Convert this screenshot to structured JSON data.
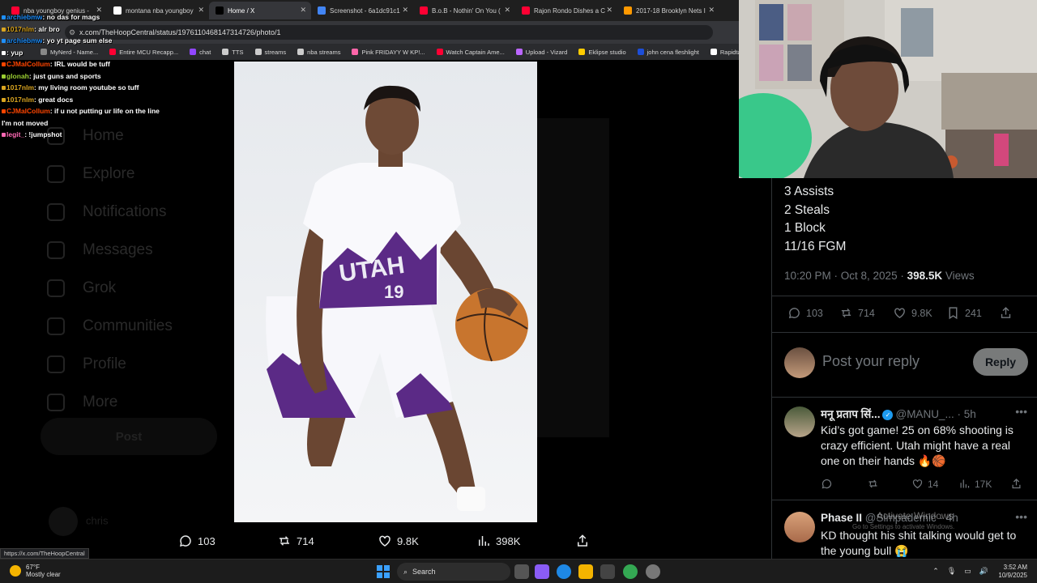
{
  "browser": {
    "tabs": [
      {
        "label": "nba youngboy genius -",
        "color": "#ff0033"
      },
      {
        "label": "montana nba youngboy",
        "color": "#ffffff"
      },
      {
        "label": "Home / X",
        "color": "#000000",
        "active": true
      },
      {
        "label": "Screenshot - 6a1dc91c1",
        "color": "#4285f4"
      },
      {
        "label": "B.o.B - Nothin' On You (",
        "color": "#ff0033"
      },
      {
        "label": "Rajon Rondo Dishes a C",
        "color": "#ff0033"
      },
      {
        "label": "2017-18 Brooklyn Nets I",
        "color": "#ff9900"
      }
    ],
    "url": "x.com/TheHoopCentral/status/1976110468147314726/photo/1",
    "bookmarks": [
      {
        "label": "MyNerd - Name...",
        "color": "#888888"
      },
      {
        "label": "Entire MCU Recapp...",
        "color": "#ff0033"
      },
      {
        "label": "chat",
        "color": "#9146ff"
      },
      {
        "label": "TTS",
        "color": "#cccccc"
      },
      {
        "label": "streams",
        "color": "#cccccc"
      },
      {
        "label": "nba streams",
        "color": "#cccccc"
      },
      {
        "label": "Pink FRIDAYY W KP!...",
        "color": "#ff66aa"
      },
      {
        "label": "Watch Captain Ame...",
        "color": "#ff0033"
      },
      {
        "label": "Upload - Vizard",
        "color": "#bb66ff"
      },
      {
        "label": "Eklipse studio",
        "color": "#ffcc00"
      },
      {
        "label": "john cena fleshlight",
        "color": "#1d4ed8"
      },
      {
        "label": "Rapidtags | YouT",
        "color": "#ffffff"
      }
    ],
    "status_url": "https://x.com/TheHoopCentral"
  },
  "chat": [
    {
      "user": "archiebmw",
      "text": "no das for mags",
      "color": "#1e90ff"
    },
    {
      "user": "1017nlm",
      "text": "alr bro",
      "color": "#daa520"
    },
    {
      "user": "archiebmw",
      "text": "yo yt page sum else",
      "color": "#1e90ff"
    },
    {
      "user": "",
      "text": "yup",
      "color": "#ffffff"
    },
    {
      "user": "CJMalCollum",
      "text": "IRL would be tuff",
      "color": "#ff4500"
    },
    {
      "user": "glonah",
      "text": "just guns and sports",
      "color": "#9acd32"
    },
    {
      "user": "1017nlm",
      "text": "my living room youtube so tuff",
      "color": "#daa520"
    },
    {
      "user": "1017nlm",
      "text": "great docs",
      "color": "#daa520"
    },
    {
      "user": "CJMalCollum",
      "text": "if u not putting ur life on the line I'm not moved",
      "color": "#ff4500"
    },
    {
      "user": "legit_",
      "text": "!jumpshot",
      "color": "#ff69b4"
    }
  ],
  "sidebar": {
    "items": [
      "Home",
      "Explore",
      "Notifications",
      "Messages",
      "Grok",
      "Communities",
      "Profile",
      "More"
    ],
    "post": "Post",
    "user": "chris"
  },
  "photo_actions": {
    "replies": "103",
    "reposts": "714",
    "likes": "9.8K",
    "views": "398K"
  },
  "tweet": {
    "stats": [
      "3 Assists",
      "2 Steals",
      "1 Block",
      "11/16 FGM"
    ],
    "time": "10:20 PM · Oct 8, 2025 · ",
    "views_count": "398.5K",
    "views_label": " Views",
    "replies": "103",
    "reposts": "714",
    "likes": "9.8K",
    "bookmarks": "241"
  },
  "reply_box": {
    "placeholder": "Post your reply",
    "button": "Reply"
  },
  "replies": [
    {
      "name": "मनू प्रताप सिं...",
      "handle": "@MANU_...",
      "time": " · 5h",
      "text": "Kid’s got game! 25 on 68% shooting is crazy efficient. Utah might have a real one on their hands 🔥🏀",
      "reposts": "",
      "likes": "14",
      "views": "17K"
    },
    {
      "name": "Phase II",
      "handle": "@Simpademic",
      "time": " · 4h",
      "text": "KD thought his shit talking would get to the young bull 😭"
    }
  ],
  "watermark": {
    "line1": "Activate Windows",
    "line2": "Go to Settings to activate Windows."
  },
  "taskbar": {
    "temp": "67°F",
    "weather": "Mostly clear",
    "search": "Search",
    "time": "3:52 AM",
    "date": "10/9/2025"
  }
}
